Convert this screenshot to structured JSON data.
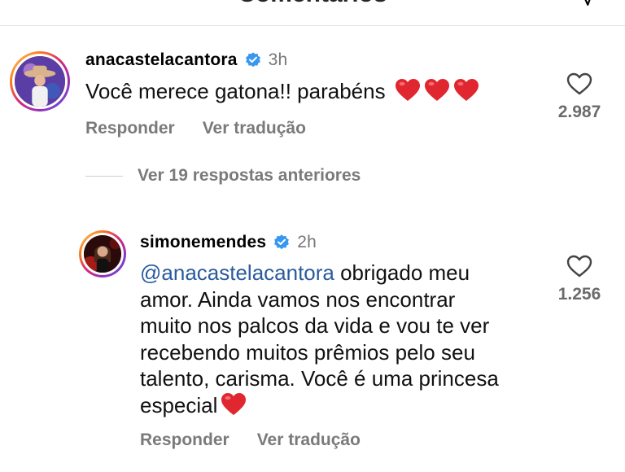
{
  "header": {
    "title": "Comentários"
  },
  "comments": [
    {
      "username": "anacastelacantora",
      "time": "3h",
      "text": "Você merece gatona!! parabéns",
      "emoji_count": 3,
      "reply_label": "Responder",
      "translate_label": "Ver tradução",
      "likes": "2.987"
    }
  ],
  "view_replies_label": "Ver 19 respostas anteriores",
  "replies": [
    {
      "username": "simonemendes",
      "time": "2h",
      "mention": "@anacastelacantora",
      "lines": [
        " obrigado meu",
        "amor. Ainda vamos nos encontrar",
        "muito nos palcos da vida e vou te ver",
        "recebendo muitos prêmios pelo seu",
        "talento, carisma. Você é uma princesa",
        "especial"
      ],
      "reply_label": "Responder",
      "translate_label": "Ver tradução",
      "likes": "1.256"
    }
  ],
  "colors": {
    "verified": "#3897f0",
    "heart_emoji": "#e0262f",
    "mention": "#2a5b9e"
  }
}
